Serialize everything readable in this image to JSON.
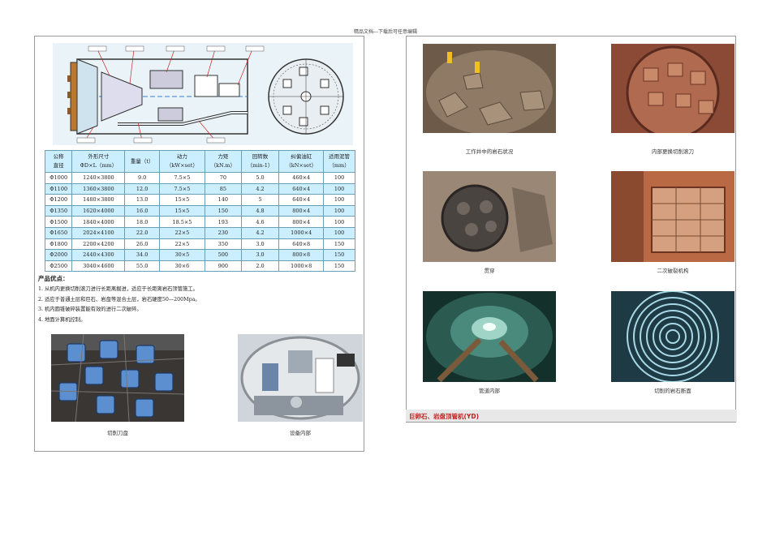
{
  "header": "精品文档---下载后可任意编辑",
  "spec_table": {
    "headers": [
      [
        "公称",
        "直径"
      ],
      [
        "外形尺寸",
        "ΦD×L（mm）"
      ],
      [
        "重量（t）"
      ],
      [
        "动力",
        "（kW×set）"
      ],
      [
        "力矩",
        "（kN.m）"
      ],
      [
        "回转数",
        "（min-1）"
      ],
      [
        "纠偏油缸",
        "（kN×set）"
      ],
      [
        "适用泥管",
        "（mm）"
      ]
    ],
    "rows": [
      [
        "Φ1000",
        "1240×3800",
        "9.0",
        "7.5×5",
        "70",
        "5.0",
        "460×4",
        "100"
      ],
      [
        "Φ1100",
        "1360×3800",
        "12.0",
        "7.5×5",
        "85",
        "4.2",
        "640×4",
        "100"
      ],
      [
        "Φ1200",
        "1480×3800",
        "13.0",
        "15×5",
        "140",
        "5",
        "640×4",
        "100"
      ],
      [
        "Φ1350",
        "1620×4000",
        "16.0",
        "15×5",
        "150",
        "4.8",
        "800×4",
        "100"
      ],
      [
        "Φ1500",
        "1840×4000",
        "18.0",
        "18.5×5",
        "193",
        "4.6",
        "800×4",
        "100"
      ],
      [
        "Φ1650",
        "2024×4100",
        "22.0",
        "22×5",
        "230",
        "4.2",
        "1000×4",
        "100"
      ],
      [
        "Φ1800",
        "2200×4200",
        "26.0",
        "22×5",
        "350",
        "3.0",
        "640×8",
        "150"
      ],
      [
        "Φ2000",
        "2440×4300",
        "34.0",
        "30×5",
        "500",
        "3.0",
        "800×8",
        "150"
      ],
      [
        "Φ2500",
        "3040×4600",
        "55.0",
        "30×6",
        "900",
        "2.0",
        "1000×8",
        "150"
      ]
    ]
  },
  "advantages": {
    "title": "产品优点：",
    "items": [
      "1. 从机内更换切削滚刀进行长距离掘进，适应于长距离岩石顶管施工。",
      "2. 适应于普通土层和巨石、岩盘等混合土层，岩石硬度50—200Mpa。",
      "3. 机内圆锥破碎装置能有效的进行二次破碎。",
      "4. 地面计算机控制。"
    ]
  },
  "left_captions": [
    "切削刀盘",
    "设备内部"
  ],
  "right_captions": [
    "工作井中的岩石状况",
    "内部更换切削滚刀",
    "贯穿",
    "二次破裂机构",
    "管道内部",
    "切削的岩石断面"
  ],
  "section_title": "巨卵石、岩盘顶管机(YD)",
  "colors": {
    "table_alt": "#ccefff",
    "title_red": "#c41e1e"
  }
}
